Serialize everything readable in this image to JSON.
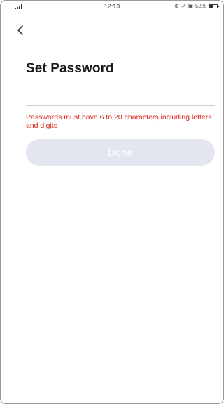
{
  "status_bar": {
    "time": "12:13",
    "battery_text": "52%"
  },
  "header": {
    "back_icon": "chevron-left-icon",
    "title": "Set Password"
  },
  "form": {
    "password_value": "",
    "error_message": "Passwords must have 6 to 20 characters,including letters and digits",
    "done_label": "Done"
  },
  "colors": {
    "error": "#d8261c",
    "button_disabled": "#e3e6ee",
    "button_text": "#ffffff"
  }
}
